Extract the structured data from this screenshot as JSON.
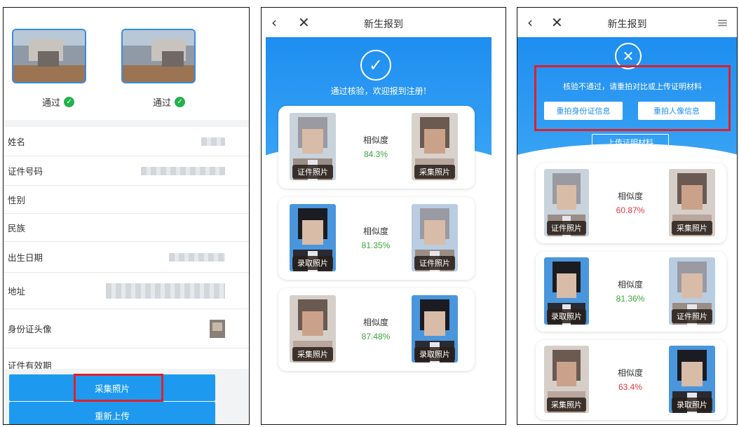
{
  "screen1": {
    "photos": [
      {
        "status": "通过"
      },
      {
        "status": "通过"
      }
    ],
    "fields": [
      {
        "label": "姓名"
      },
      {
        "label": "证件号码"
      },
      {
        "label": "性别"
      },
      {
        "label": "民族"
      },
      {
        "label": "出生日期"
      },
      {
        "label": "地址"
      },
      {
        "label": "身份证头像"
      },
      {
        "label": "证件有效期"
      }
    ],
    "buttons": {
      "collect": "采集照片",
      "reupload": "重新上传"
    }
  },
  "screen2": {
    "nav": {
      "title": "新生报到",
      "back": "‹",
      "close": "✕"
    },
    "banner": {
      "icon": "check-circle-icon",
      "message": "通过核验，欢迎报到注册!"
    },
    "similarity_label": "相似度",
    "cards": [
      {
        "left": "证件照片",
        "right": "采集照片",
        "value": "84.3%"
      },
      {
        "left": "录取照片",
        "right": "证件照片",
        "value": "81.35%"
      },
      {
        "left": "采集照片",
        "right": "录取照片",
        "value": "87.48%"
      }
    ]
  },
  "screen3": {
    "nav": {
      "title": "新生报到",
      "back": "‹",
      "close": "✕",
      "menu": "≡"
    },
    "banner": {
      "icon": "x-circle-icon",
      "message": "核验不通过，请重拍对比或上传证明材料"
    },
    "buttons": {
      "retake_id": "重拍身份证信息",
      "retake_portrait": "重拍人像信息",
      "upload": "上传证明材料"
    },
    "similarity_label": "相似度",
    "cards": [
      {
        "left": "证件照片",
        "right": "采集照片",
        "value": "60.87%"
      },
      {
        "left": "录取照片",
        "right": "证件照片",
        "value": "81.36%"
      },
      {
        "left": "采集照片",
        "right": "录取照片",
        "value": "63.4%"
      }
    ]
  },
  "colors": {
    "accent": "#1d9af0",
    "pass": "#22b14c",
    "sim_ok": "#3aa83a",
    "sim_fail": "#e0383e",
    "highlight": "#e0202a"
  }
}
